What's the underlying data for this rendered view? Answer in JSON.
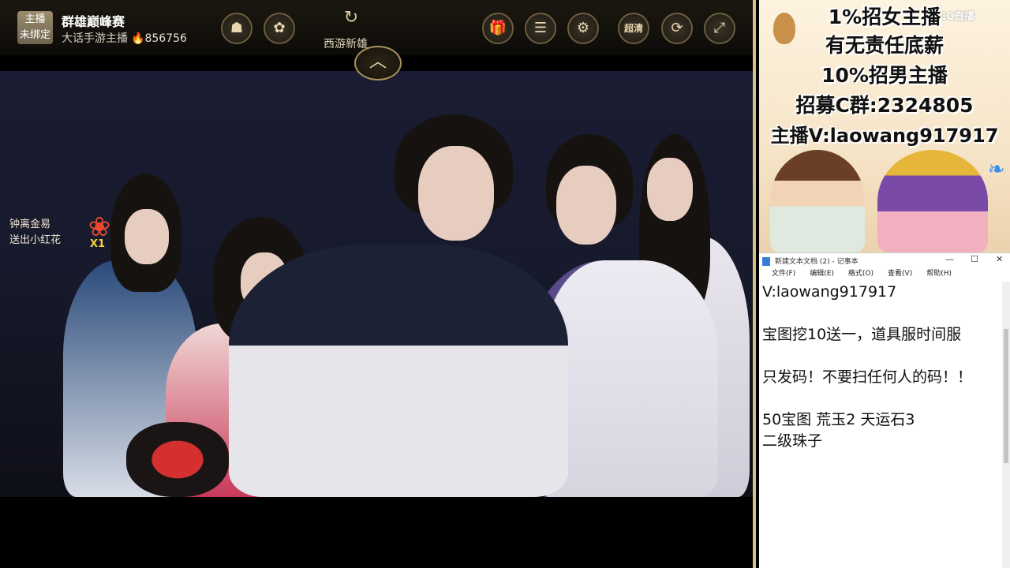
{
  "header": {
    "host_badge_line1": "主播",
    "host_badge_line2": "未绑定",
    "room_title": "群雄巅峰赛",
    "room_subtitle": "大话手游主播",
    "heat": "856756",
    "xiyou_label": "西游新雄",
    "hd_label": "超清"
  },
  "gift_notice": {
    "line1": "钟离金易",
    "line2": "送出小红花",
    "count": "X1"
  },
  "promo": {
    "lines": [
      "1%招女主播",
      "有无责任底薪",
      "10%招男主播",
      "招募C群:2324805",
      "主播V:laowang917917"
    ],
    "logo": "CC直播"
  },
  "notepad": {
    "title": "新建文本文档 (2) - 记事本",
    "menu": [
      "文件(F)",
      "编辑(E)",
      "格式(O)",
      "查看(V)",
      "帮助(H)"
    ],
    "lines": [
      "V:laowang917917",
      "",
      "宝图挖10送一，道具服时间服",
      "",
      "只发码！不要扫任何人的码！！",
      "",
      "50宝图 荒玉2  天运石3",
      "二级珠子"
    ]
  }
}
